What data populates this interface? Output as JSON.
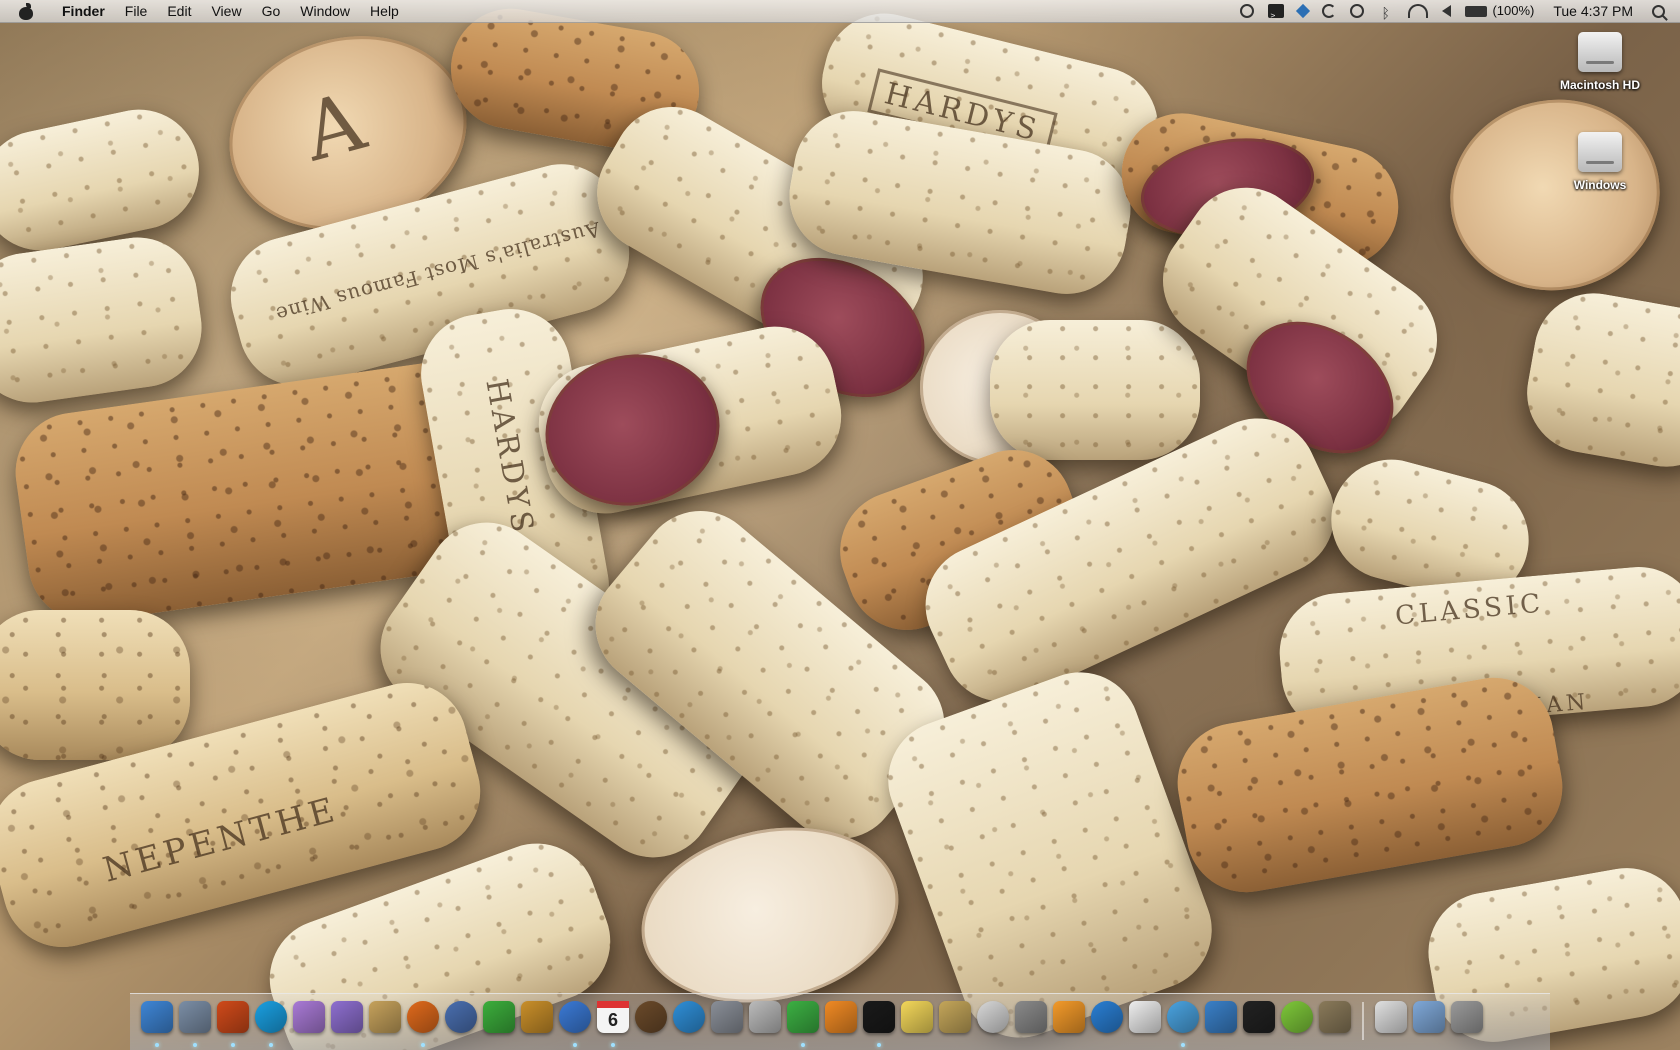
{
  "menubar": {
    "app_name": "Finder",
    "menus": [
      "File",
      "Edit",
      "View",
      "Go",
      "Window",
      "Help"
    ],
    "battery_text": "(100%)",
    "clock": "Tue 4:37 PM"
  },
  "desktop": {
    "icons": [
      {
        "label": "Macintosh HD",
        "icon": "hard-drive-icon"
      },
      {
        "label": "Windows",
        "icon": "hard-drive-icon"
      }
    ]
  },
  "wallpaper": {
    "cork_stamps": [
      "HARDYS",
      "A",
      "Australia's Most Famous Wine",
      "NEPENTHE",
      "CLASSIC",
      "ITALIAN",
      "HARDYS"
    ]
  },
  "dock": {
    "items": [
      {
        "icon": "finder-icon",
        "color": "#3f86d6",
        "running": true
      },
      {
        "icon": "preview-icon",
        "color": "#7b8ea6",
        "running": true
      },
      {
        "icon": "audio-icon",
        "color": "#d04a1a",
        "running": true
      },
      {
        "icon": "skype-icon",
        "color": "#1aa0e2",
        "running": true
      },
      {
        "icon": "e-icon",
        "color": "#a97ad6",
        "running": false
      },
      {
        "icon": "w-icon",
        "color": "#8e6fd0",
        "running": false
      },
      {
        "icon": "notes-icon",
        "color": "#c6a25c",
        "running": false
      },
      {
        "icon": "firefox-icon",
        "color": "#e06a1c",
        "running": true
      },
      {
        "icon": "thunderbird-icon",
        "color": "#4a6fb0",
        "running": false
      },
      {
        "icon": "network-icon",
        "color": "#3cae3c",
        "running": false
      },
      {
        "icon": "pineapple-icon",
        "color": "#c98f2a",
        "running": false
      },
      {
        "icon": "globe-icon",
        "color": "#3b7ad6",
        "running": true
      },
      {
        "icon": "calendar-icon",
        "color": "#e8e8e8",
        "day": "6",
        "running": true
      },
      {
        "icon": "speaker-icon",
        "color": "#6b4a2a",
        "running": false
      },
      {
        "icon": "internet-icon",
        "color": "#2f8fd8",
        "running": false
      },
      {
        "icon": "calculator-icon",
        "color": "#8a8f98",
        "running": false
      },
      {
        "icon": "dvd-icon",
        "color": "#bbbbbb",
        "running": false
      },
      {
        "icon": "adium-icon",
        "color": "#3cb043",
        "running": true
      },
      {
        "icon": "p-icon",
        "color": "#f08a24",
        "running": false
      },
      {
        "icon": "terminal-icon",
        "color": "#1a1a1a",
        "running": true
      },
      {
        "icon": "stickies-icon",
        "color": "#f3d75a",
        "running": false
      },
      {
        "icon": "truck-icon",
        "color": "#c4a65a",
        "running": false
      },
      {
        "icon": "gender-icon",
        "color": "#d8d8d8",
        "running": false
      },
      {
        "icon": "system-preferences-icon",
        "color": "#8a8a8a",
        "running": false
      },
      {
        "icon": "flower-icon",
        "color": "#f39a2a",
        "running": false
      },
      {
        "icon": "quicktime-icon",
        "color": "#2a7fd4",
        "running": false
      },
      {
        "icon": "documents-icon",
        "color": "#eeeeee",
        "running": false
      },
      {
        "icon": "itunes-icon",
        "color": "#4aa3e0",
        "running": true
      },
      {
        "icon": "people-icon",
        "color": "#3a80c8",
        "running": false
      },
      {
        "icon": "arrows-icon",
        "color": "#222222",
        "running": false
      },
      {
        "icon": "green-ball-icon",
        "color": "#7ec83a",
        "running": false
      },
      {
        "icon": "gimp-icon",
        "color": "#8a7a5a",
        "running": false
      }
    ],
    "stacks": [
      {
        "icon": "printer-icon",
        "color": "#e0e0e0"
      },
      {
        "icon": "folder-icon",
        "color": "#7fa8d8"
      },
      {
        "icon": "trash-icon",
        "color": "#9a9a9a"
      }
    ]
  }
}
